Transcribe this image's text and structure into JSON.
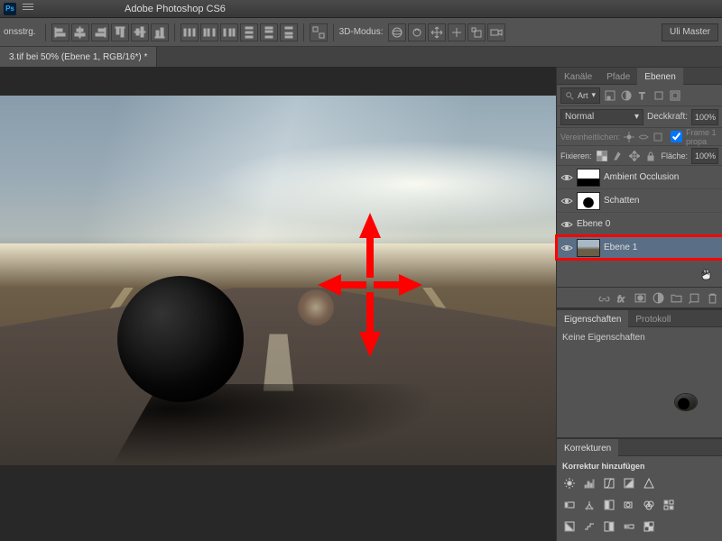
{
  "app": {
    "title": "Adobe Photoshop CS6",
    "ps": "Ps"
  },
  "options": {
    "left_label": "onsstrg.",
    "mode_3d": "3D-Modus:",
    "workspace": "Uli Master"
  },
  "doc_tab": "3.tif bei 50% (Ebene 1, RGB/16*) *",
  "panels": {
    "tabs": {
      "kanaele": "Kanäle",
      "pfade": "Pfade",
      "ebenen": "Ebenen"
    },
    "filter": "Art",
    "blend": {
      "mode": "Normal",
      "opacity_label": "Deckkraft:",
      "opacity": "100%"
    },
    "vereinheitlichen": "Vereinheitlichen:",
    "frame": "Frame 1 propa",
    "fixieren": "Fixieren:",
    "flaeche_label": "Fläche:",
    "flaeche": "100%",
    "layers": [
      {
        "name": "Ambient Occlusion"
      },
      {
        "name": "Schatten"
      },
      {
        "name": "Ebene 0"
      },
      {
        "name": "Ebene 1"
      }
    ],
    "eigenschaften": {
      "tab1": "Eigenschaften",
      "tab2": "Protokoll",
      "empty": "Keine Eigenschaften"
    },
    "korrekturen": {
      "title": "Korrekturen",
      "add": "Korrektur hinzufügen"
    }
  }
}
